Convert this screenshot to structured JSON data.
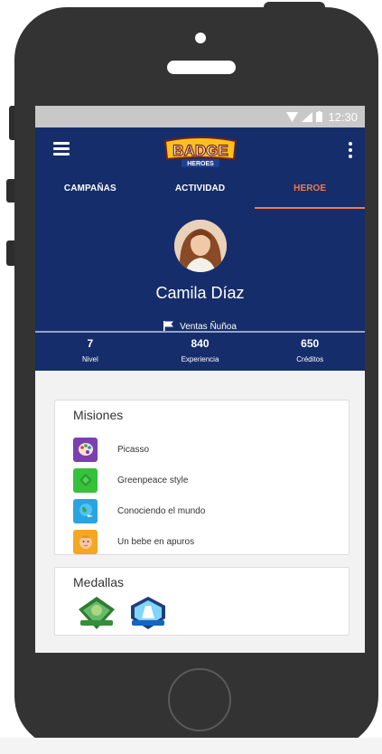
{
  "status_bar": {
    "time": "12:30"
  },
  "app": {
    "logo_text": "BADGE",
    "logo_subtext": "HEROES"
  },
  "tabs": [
    {
      "label": "CAMPAÑAS"
    },
    {
      "label": "ACTIVIDAD"
    },
    {
      "label": "HEROE"
    }
  ],
  "profile": {
    "name": "Camila Díaz",
    "place": "Ventas Ñuñoa"
  },
  "stats": [
    {
      "value": "7",
      "label": "Nivel"
    },
    {
      "value": "840",
      "label": "Experiencia"
    },
    {
      "value": "650",
      "label": "Créditos"
    }
  ],
  "missions": {
    "title": "Misiones",
    "items": [
      {
        "label": "Picasso",
        "icon": "palette-icon",
        "color": "#7b3fb0"
      },
      {
        "label": "Greenpeace style",
        "icon": "leaf-icon",
        "color": "#35c23a"
      },
      {
        "label": "Conociendo el mundo",
        "icon": "globe-icon",
        "color": "#2aa4e0"
      },
      {
        "label": "Un bebe en apuros",
        "icon": "baby-icon",
        "color": "#f5a623"
      }
    ]
  },
  "medals": {
    "title": "Medallas",
    "items": [
      {
        "icon": "green-medal-icon"
      },
      {
        "icon": "blue-medal-icon"
      }
    ]
  },
  "colors": {
    "primary": "#162d6b",
    "accent": "#f27a4e",
    "phone": "#333333"
  }
}
